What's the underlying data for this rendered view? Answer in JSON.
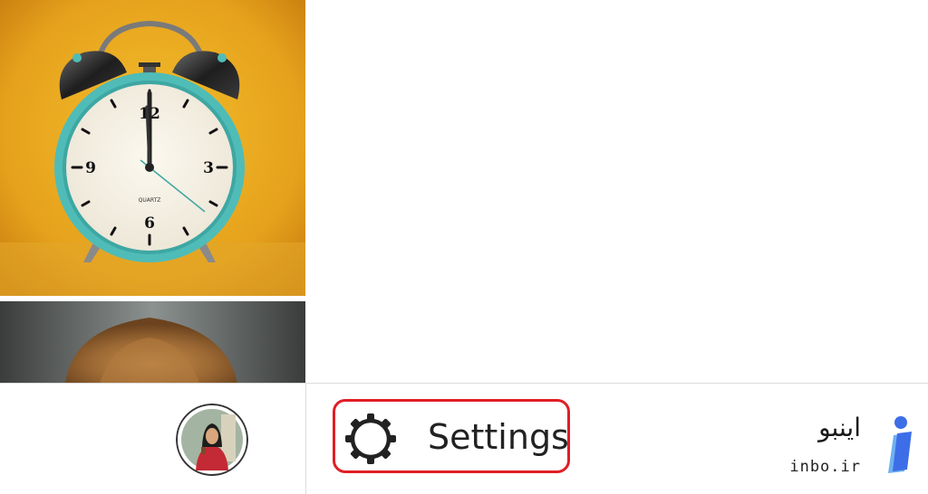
{
  "photos": [
    {
      "name": "alarm-clock-photo",
      "subject": "alarm clock",
      "clock_text": {
        "n12": "12",
        "n3": "3",
        "n6": "6",
        "n9": "9",
        "brand": "QUARTZ"
      }
    },
    {
      "name": "hair-photo",
      "subject": "child hair"
    }
  ],
  "bottom_bar": {
    "settings_label": "Settings"
  },
  "watermark": {
    "persian": "اینبو",
    "domain": "inbo.ir"
  },
  "colors": {
    "highlight": "#e01e27",
    "clock_bg": "#e8a21a",
    "clock_rim": "#4fbcb8",
    "logo_blue": "#3d6ee8",
    "logo_light": "#6fb1f0"
  },
  "icons": {
    "settings": "gear-icon",
    "avatar": "profile-avatar",
    "logo": "inbo-logo-icon"
  }
}
